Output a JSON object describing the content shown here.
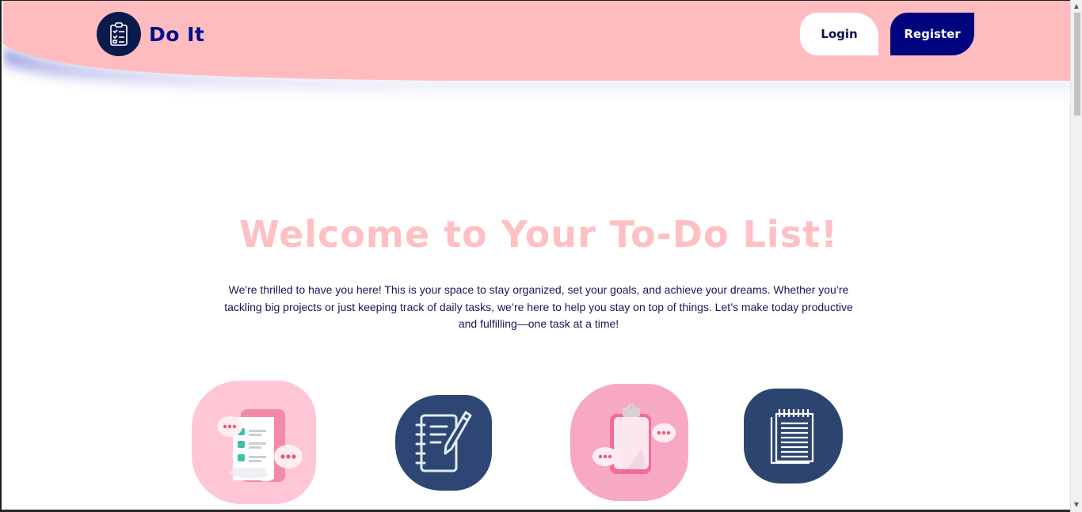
{
  "app": {
    "brand": "Do It",
    "logo_icon": "clipboard-checklist-icon"
  },
  "nav": {
    "login_label": "Login",
    "register_label": "Register"
  },
  "hero": {
    "title": "Welcome to Your To-Do List!",
    "description": "We're thrilled to have you here! This is your space to stay organized, set your goals, and achieve your dreams. Whether you’re tackling big projects or just keeping track of daily tasks, we’re here to help you stay on top of things. Let’s make today productive and fulfilling—one task at a time!"
  },
  "features": [
    {
      "icon": "checklist-document-icon"
    },
    {
      "icon": "notebook-pen-icon"
    },
    {
      "icon": "clipboard-chat-icon"
    },
    {
      "icon": "notepad-icon"
    }
  ],
  "colors": {
    "header_bg": "#ffbcbf",
    "header_shadow": "#5a5fd0",
    "brand_text": "#000f8c",
    "logo_circle": "#0b1a4d",
    "register_bg": "#00047e",
    "title_pink": "#ffc0c3",
    "body_text": "#16165a",
    "icon_navy": "#2d4673",
    "icon_pink": "#ffc6d6"
  }
}
